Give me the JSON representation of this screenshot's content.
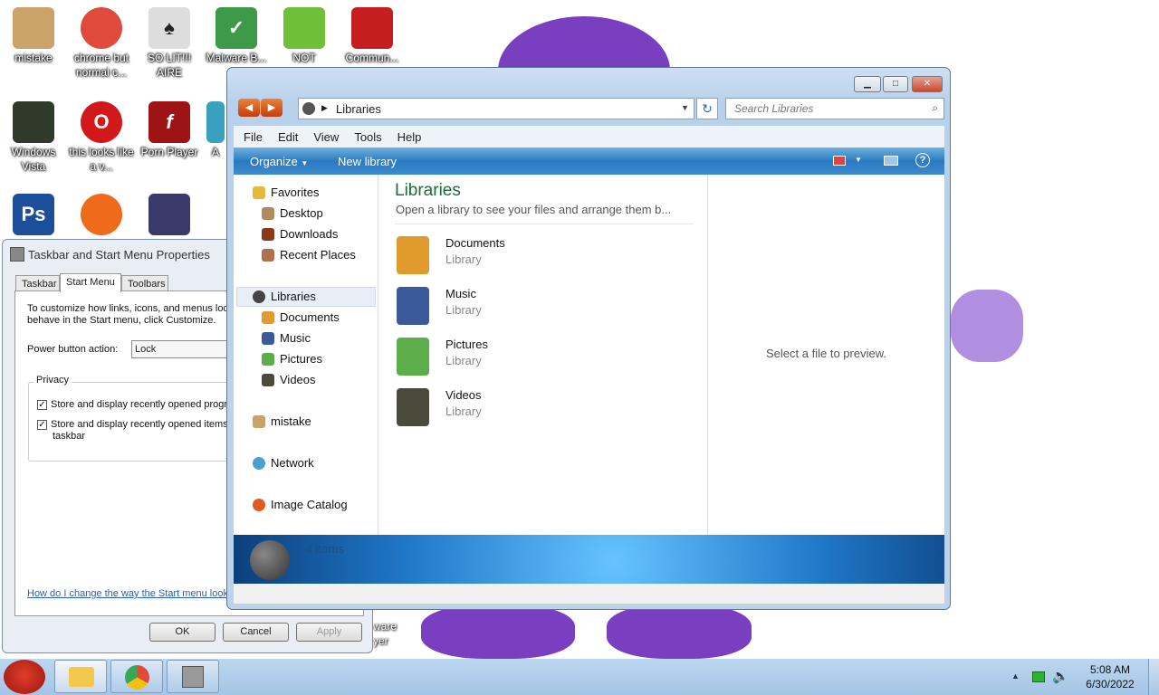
{
  "desktop": {
    "icons": [
      {
        "label": "mistake",
        "color": "#caa26a"
      },
      {
        "label": "chrome but normal c...",
        "color": "#e04a3a"
      },
      {
        "label": "SO LIT!!! AIRE",
        "color": "#dddddd"
      },
      {
        "label": "Malware B...",
        "color": "#3e9a48"
      },
      {
        "label": "NOT",
        "color": "#6fbf3a"
      },
      {
        "label": "Commun...",
        "color": "#c41e1e"
      },
      {
        "label": "Windows Vista",
        "color": "#2f3a2a"
      },
      {
        "label": "this looks like a v...",
        "color": "#d21818"
      },
      {
        "label": "Porn Player",
        "color": "#9e1313"
      },
      {
        "label": "Ps",
        "color": "#1d4e9a"
      },
      {
        "label": "",
        "color": "#f06a1b"
      },
      {
        "label": "",
        "color": "#3a3a6a"
      }
    ],
    "partial_text_a": "A",
    "partial_text_b": "ware",
    "partial_text_c": "yer"
  },
  "taskbar_dialog": {
    "title": "Taskbar and Start Menu Properties",
    "tabs": [
      "Taskbar",
      "Start Menu",
      "Toolbars"
    ],
    "intro_line1": "To customize how links, icons, and menus look",
    "intro_line2": "behave in the Start menu, click Customize.",
    "power_label": "Power button action:",
    "power_value": "Lock",
    "privacy_label": "Privacy",
    "privacy_items": [
      "Store and display recently opened progra",
      "Store and display recently opened items",
      "taskbar"
    ],
    "help_link": "How do I change the way the Start menu look",
    "buttons": {
      "ok": "OK",
      "cancel": "Cancel",
      "apply": "Apply"
    }
  },
  "explorer": {
    "address": "Libraries",
    "search_placeholder": "Search Libraries",
    "menu": [
      "File",
      "Edit",
      "View",
      "Tools",
      "Help"
    ],
    "organize": "Organize",
    "new_library": "New library",
    "nav": {
      "favorites": "Favorites",
      "fav_items": [
        "Desktop",
        "Downloads",
        "Recent Places"
      ],
      "libraries": "Libraries",
      "lib_items": [
        "Documents",
        "Music",
        "Pictures",
        "Videos"
      ],
      "user": "mistake",
      "network": "Network",
      "catalog": "Image Catalog"
    },
    "heading": "Libraries",
    "subheading": "Open a library to see your files and arrange them b...",
    "libraries": [
      {
        "name": "Documents",
        "type": "Library",
        "color": "#e09a2e"
      },
      {
        "name": "Music",
        "type": "Library",
        "color": "#3a5a9a"
      },
      {
        "name": "Pictures",
        "type": "Library",
        "color": "#5cae4a"
      },
      {
        "name": "Videos",
        "type": "Library",
        "color": "#4a4a3a"
      }
    ],
    "preview_text": "Select a file to preview.",
    "items_count": "4 items"
  },
  "clock": {
    "time": "5:08 AM",
    "date": "6/30/2022"
  }
}
